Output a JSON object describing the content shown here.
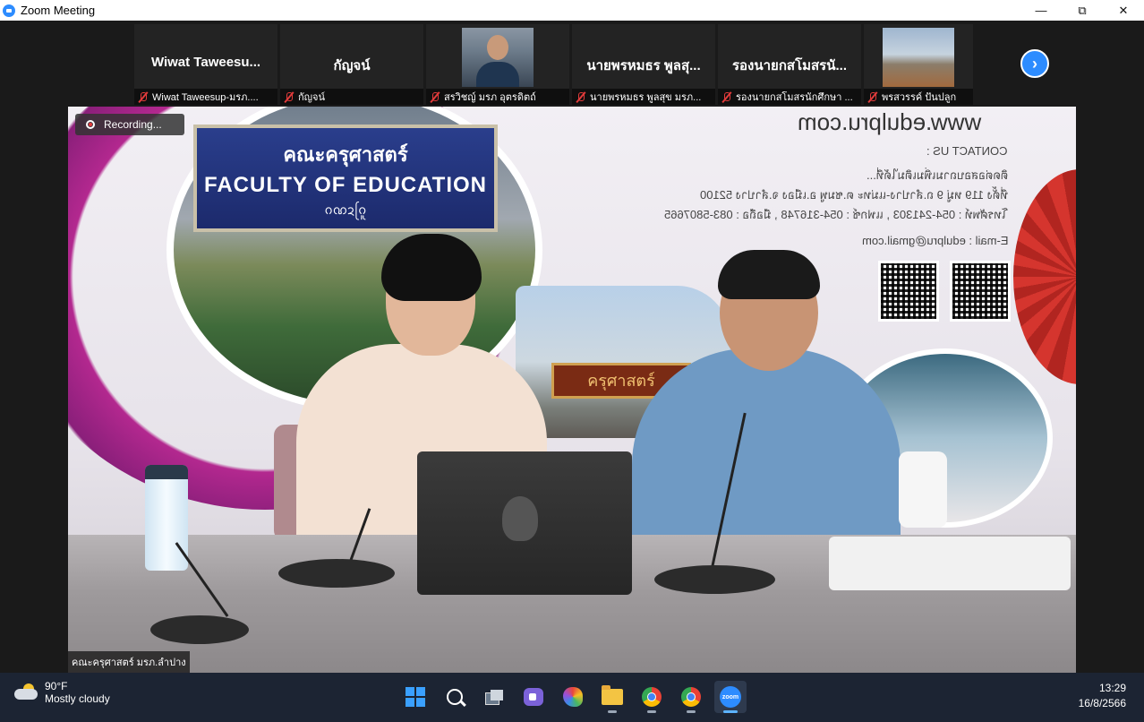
{
  "window": {
    "title": "Zoom Meeting",
    "controls": {
      "minimize": "—",
      "maximize": "⧉",
      "close": "✕"
    }
  },
  "thumbnails": [
    {
      "display_name": "Wiwat  Taweesu...",
      "footer": "Wiwat Taweesup-มรภ....",
      "video": "none",
      "muted": true
    },
    {
      "display_name": "กัญจน์",
      "footer": "กัญจน์",
      "video": "none",
      "muted": true
    },
    {
      "display_name": "",
      "footer": "สรวิชญ์ มรภ อุตรดิตถ์",
      "video": "person",
      "muted": true
    },
    {
      "display_name": "นายพรหมธร พูลสุ...",
      "footer": "นายพรหมธร พูลสุข มรภ...",
      "video": "none",
      "muted": true
    },
    {
      "display_name": "รองนายกสโมสรนั...",
      "footer": "รองนายกสโมสรนักศึกษา ...",
      "video": "none",
      "muted": true
    },
    {
      "display_name": "",
      "footer": "พรสวรรค์ ปันปลูก",
      "video": "landscape",
      "muted": true
    }
  ],
  "next_page_icon": "chevron-right-icon",
  "recording": {
    "label": "Recording..."
  },
  "main_video": {
    "participant_name": "คณะครุศาสตร์ มรภ.ลำปาง",
    "banner": {
      "sign_thai": "คณะครุศาสตร์",
      "sign_en": "FACULTY OF EDUCATION",
      "sign_lanna": "ᨣᨱᨯᨣᩕᩪ",
      "url": "www.edulpru.com",
      "contact_heading": "CONTACT US :",
      "contact_lines": [
        "ติดต่อสอบถามเพิ่มเติมได้ที่...",
        "ที่ตั้ง 119 หมู่ 9 ถ.ลำปาง-แม่ทะ ต.ชมพู อ.เมือง จ.ลำปาง 52100",
        "โทรศัพท์ : 054-241303 , แฟกซ์ : 054-316748 , มือถือ : 083-5807665",
        "E-mail : edulpru@gmail.com"
      ],
      "banner_small_sign": "ครุศาสตร์"
    }
  },
  "taskbar": {
    "weather": {
      "temp": "90°F",
      "desc": "Mostly cloudy"
    },
    "time": "13:29",
    "date": "16/8/2566",
    "zoom_label": "zoom"
  },
  "colors": {
    "zoom_blue": "#2d8cff",
    "muted_red": "#e23b3b",
    "taskbar": "#1c2433"
  }
}
